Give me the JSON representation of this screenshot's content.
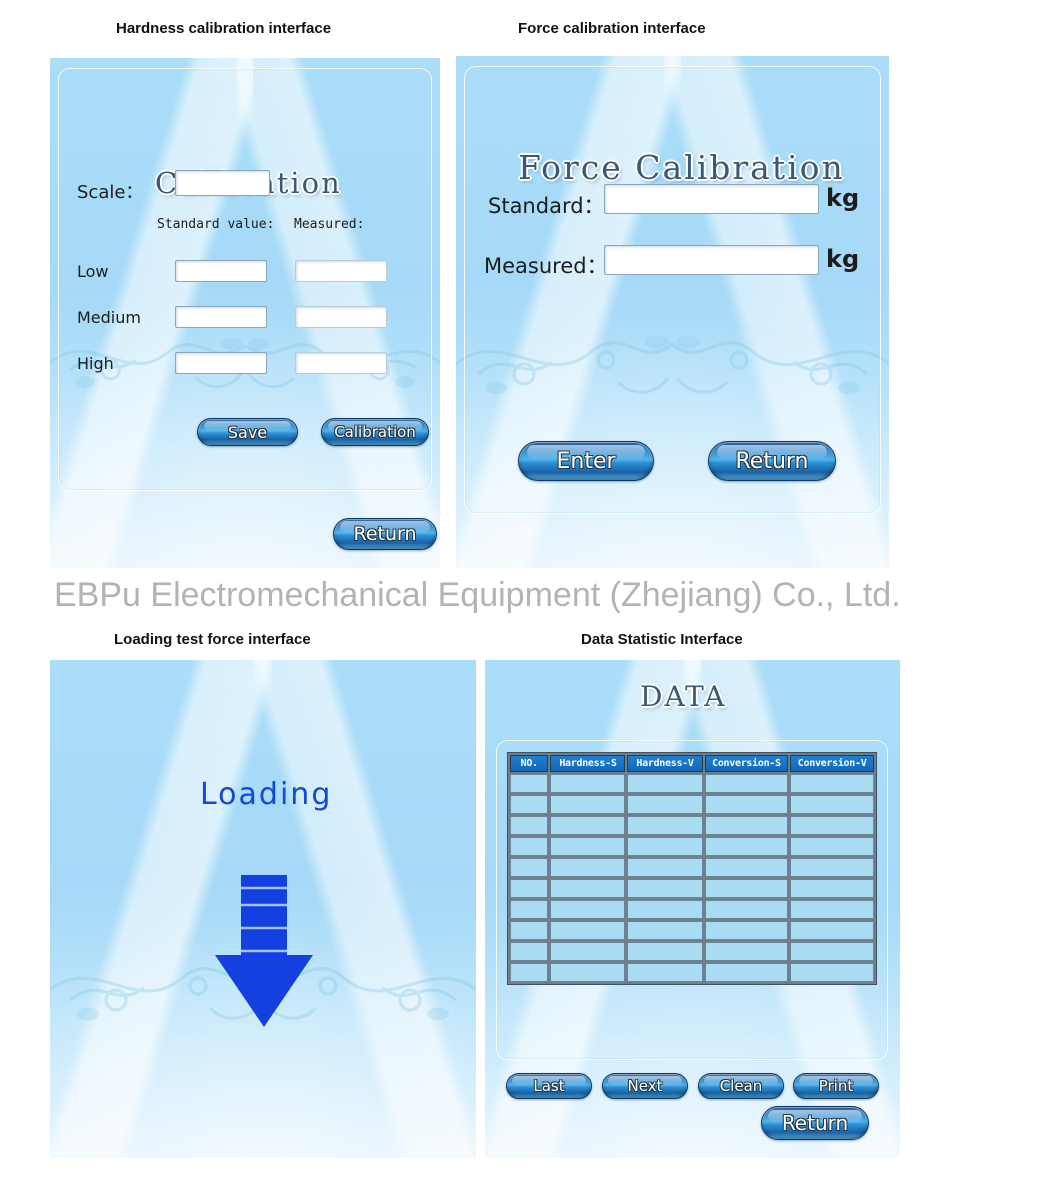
{
  "captions": {
    "hardness": "Hardness calibration interface",
    "force": "Force calibration interface",
    "loading": "Loading test force interface",
    "data": "Data Statistic Interface"
  },
  "company": "EBPu Electromechanical Equipment (Zhejiang) Co., Ltd.",
  "hardness_panel": {
    "title": "Calibration",
    "scale_label": "Scale：",
    "col_standard": "Standard value:",
    "col_measured": "Measured:",
    "rows": [
      {
        "label": "Low"
      },
      {
        "label": "Medium"
      },
      {
        "label": "High"
      }
    ],
    "scale_value": "",
    "values": {
      "low_standard": "",
      "low_measured": "",
      "medium_standard": "",
      "medium_measured": "",
      "high_standard": "",
      "high_measured": ""
    },
    "save_button": "Save",
    "calibration_button": "Calibration",
    "return_button": "Return"
  },
  "force_panel": {
    "title": "Force Calibration",
    "standard_label": "Standard：",
    "measured_label": "Measured：",
    "unit": "kg",
    "standard_value": "",
    "measured_value": "",
    "enter_button": "Enter",
    "return_button": "Return"
  },
  "loading_panel": {
    "status_text": "Loading",
    "arrow_icon": "down-arrow-icon",
    "arrow_color": "#1540e0"
  },
  "data_panel": {
    "title": "DATA",
    "columns": [
      "NO.",
      "Hardness-S",
      "Hardness-V",
      "Conversion-S",
      "Conversion-V"
    ],
    "row_count": 10,
    "rows": [
      [
        "",
        "",
        "",
        "",
        ""
      ],
      [
        "",
        "",
        "",
        "",
        ""
      ],
      [
        "",
        "",
        "",
        "",
        ""
      ],
      [
        "",
        "",
        "",
        "",
        ""
      ],
      [
        "",
        "",
        "",
        "",
        ""
      ],
      [
        "",
        "",
        "",
        "",
        ""
      ],
      [
        "",
        "",
        "",
        "",
        ""
      ],
      [
        "",
        "",
        "",
        "",
        ""
      ],
      [
        "",
        "",
        "",
        "",
        ""
      ],
      [
        "",
        "",
        "",
        "",
        ""
      ]
    ],
    "last_button": "Last",
    "next_button": "Next",
    "clean_button": "Clean",
    "print_button": "Print",
    "return_button": "Return"
  },
  "colors": {
    "screen_blue": "#a9ddf8",
    "accent_blue": "#1268b8",
    "title_navy": "#3c5878",
    "arrow_blue": "#1540e0",
    "company_gray": "#b3b3b3"
  }
}
